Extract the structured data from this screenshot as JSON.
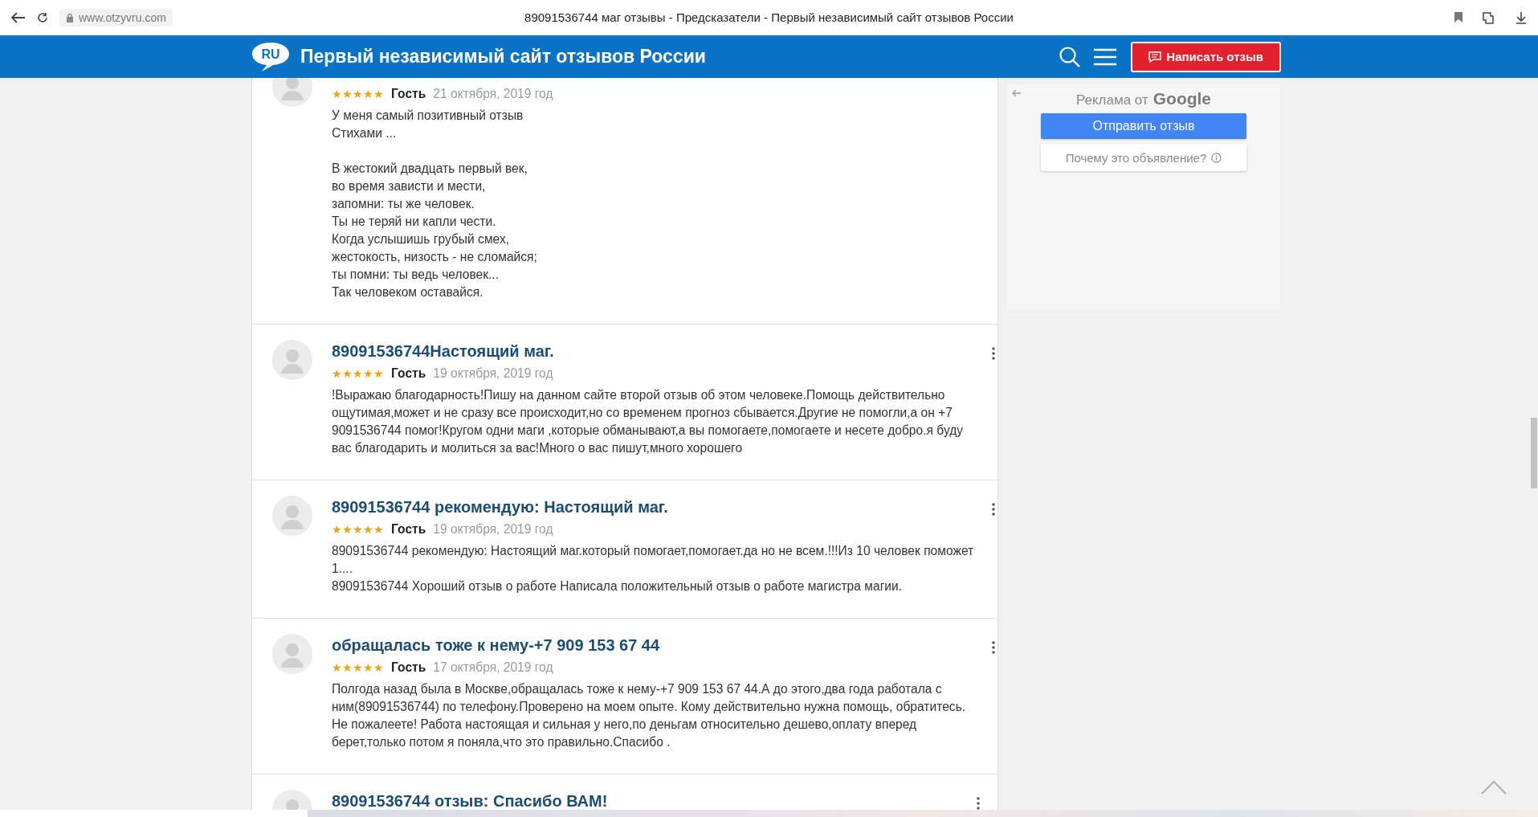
{
  "browser": {
    "url": "www.otzyvru.com",
    "title": "89091536744 маг отзывы - Предсказатели - Первый независимый сайт отзывов России"
  },
  "header": {
    "logo": "RU",
    "title": "Первый независимый сайт отзывов России",
    "button": "Написать отзыв"
  },
  "reviews": [
    {
      "stars": 5,
      "author": "Гость",
      "date": "21 октября, 2019 год",
      "body": [
        [
          "У меня самый позитивный отзыв",
          "Стихами ..."
        ],
        [
          "В жестокий двадцать первый век,",
          "во время зависти и мести,",
          "запомни: ты же человек.",
          "Ты не теряй ни капли чести.",
          "Когда услышишь грубый смех,",
          "жестокость, низость - не сломайся;",
          "ты помни: ты ведь человек...",
          "Так человеком оставайся."
        ]
      ]
    },
    {
      "title": "89091536744Настоящий маг.",
      "stars": 5,
      "author": "Гость",
      "date": "19 октября, 2019 год",
      "body": [
        [
          "!Выражаю благодарность!Пишу на данном сайте второй отзыв об этом человеке.Помощь действительно ощутимая,может и не сразу все происходит,но со временем прогноз сбывается.Другие не помогли,а он +7 9091536744 помог!Кругом одни маги ,которые обманывают,а вы помогаете,помогаете и несете добро.я буду вас благодарить и молиться за вас!Много о вас пишут,много хорошего"
        ]
      ]
    },
    {
      "title": "89091536744 рекомендую: Настоящий маг.",
      "stars": 5,
      "author": "Гость",
      "date": "19 октября, 2019 год",
      "body": [
        [
          "89091536744 рекомендую: Настоящий маг.который помогает,помогает.да но не всем.!!!Из 10 человек поможет 1....",
          "89091536744 Хороший отзыв о работе Написала положительный отзыв о работе магистра магии."
        ]
      ]
    },
    {
      "title": "обращалась тоже к нему-+7 909 153 67 44",
      "stars": 5,
      "author": "Гость",
      "date": "17 октября, 2019 год",
      "body": [
        [
          "Полгода назад была в Москве,обращалась тоже к нему-+7 909 153 67 44.А до этого,два года работала с ним(89091536744) по телефону.Проверено на моем опыте. Кому действительно нужна помощь, обратитесь. Не пожалеете! Работа настоящая и сильная у него,по деньгам относительно дешево,оплату вперед берет,только потом я поняла,что это правильно.Спасибо ."
        ]
      ]
    },
    {
      "title": "89091536744 отзыв: Спасибо ВАМ!"
    }
  ],
  "ad": {
    "label": "Реклама от",
    "brand": "Google",
    "primary": "Отправить отзыв",
    "secondary": "Почему это объявление?"
  }
}
